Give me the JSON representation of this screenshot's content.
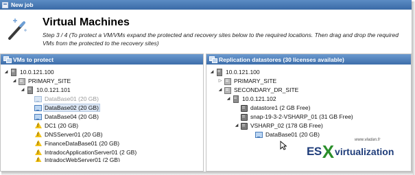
{
  "window": {
    "title": "New job"
  },
  "header": {
    "title": "Virtual Machines",
    "description": "Step 3 / 4 (To protect a VM/VMs expand the protected and recovery sites below to the required locations. Then drag and drop the required VMs from the protected to the recovery sites)"
  },
  "left_panel": {
    "title": "VMs to protect",
    "items": [
      {
        "label": "10.0.121.100"
      },
      {
        "label": "PRIMARY_SITE"
      },
      {
        "label": "10.0.121.101"
      },
      {
        "label": "DataBase01 (20 GB)"
      },
      {
        "label": "DataBase02 (20 GB)"
      },
      {
        "label": "DataBase04 (20 GB)"
      },
      {
        "label": "DC1 (20 GB)"
      },
      {
        "label": "DNSServer01 (20 GB)"
      },
      {
        "label": "FinanceDataBase01 (20 GB)"
      },
      {
        "label": "IntradocApplicationServer01 (2 GB)"
      },
      {
        "label": "IntradocWebServer01 (2 GB)"
      }
    ]
  },
  "right_panel": {
    "title": "Replication datastores (30 licenses available)",
    "items": [
      {
        "label": "10.0.121.100"
      },
      {
        "label": "PRIMARY_SITE"
      },
      {
        "label": "SECONDARY_DR_SITE"
      },
      {
        "label": "10.0.121.102"
      },
      {
        "label": "datastore1 (2 GB Free)"
      },
      {
        "label": "snap-19-3-2-VSHARP_01 (31 GB Free)"
      },
      {
        "label": "VSHARP_02 (178 GB Free)"
      },
      {
        "label": "DataBase01 (20 GB)"
      }
    ]
  },
  "watermark": {
    "site": "www.vladan.fr",
    "es": "ES",
    "x": "X",
    "rest": "virtualization"
  },
  "colors": {
    "header_blue": "#3d6eaa",
    "selection": "#dbe6f4",
    "warning": "#f3c316",
    "dimmed_text": "#9a9a9a"
  }
}
